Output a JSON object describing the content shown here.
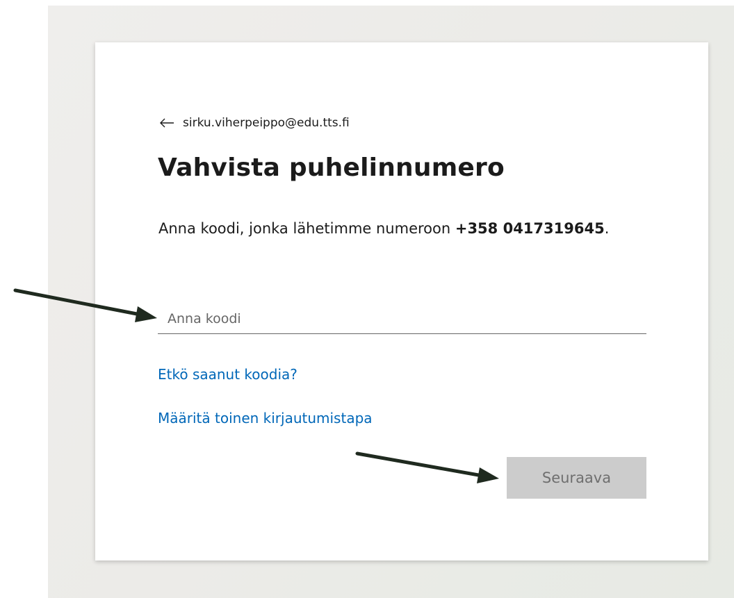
{
  "identity": {
    "email": "sirku.viherpeippo@edu.tts.fi",
    "back_icon": "back-arrow-icon"
  },
  "title": "Vahvista puhelinnumero",
  "description": {
    "text_before": "Anna koodi, jonka lähetimme numeroon ",
    "phone_number": "+358 0417319645",
    "text_after": "."
  },
  "code_field": {
    "placeholder": "Anna koodi",
    "value": ""
  },
  "links": {
    "no_code": "Etkö saanut koodia?",
    "other_method": "Määritä toinen kirjautumistapa"
  },
  "next_button": {
    "label": "Seuraava",
    "enabled": false
  },
  "colors": {
    "link": "#0067b8",
    "button_disabled_bg": "#cccccc",
    "button_disabled_text": "#6f6f6f",
    "annotation_arrow": "#1f2a1f"
  }
}
